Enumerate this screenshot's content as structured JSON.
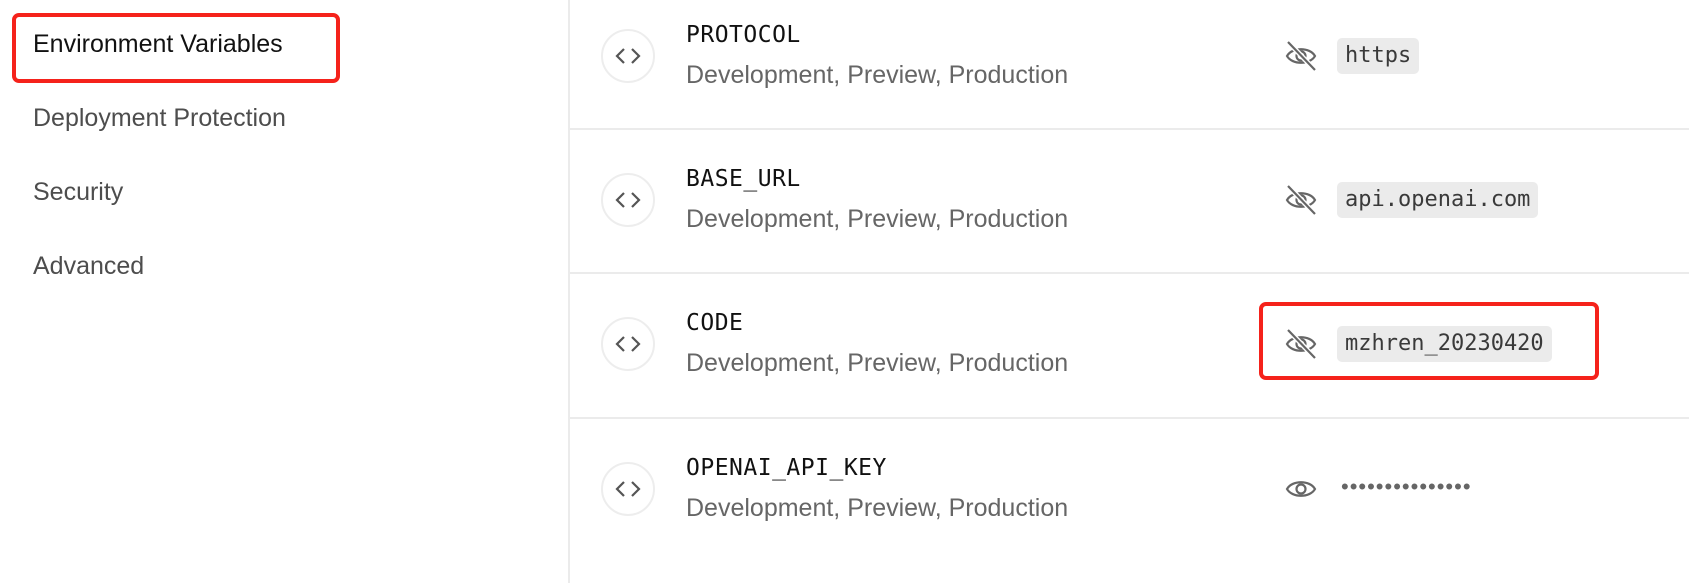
{
  "sidebar": {
    "items": [
      {
        "label": "Environment Variables",
        "active": true
      },
      {
        "label": "Deployment Protection"
      },
      {
        "label": "Security"
      },
      {
        "label": "Advanced"
      }
    ]
  },
  "env_vars": [
    {
      "name": "PROTOCOL",
      "environments": "Development, Preview, Production",
      "value": "https",
      "visible": true
    },
    {
      "name": "BASE_URL",
      "environments": "Development, Preview, Production",
      "value": "api.openai.com",
      "visible": true
    },
    {
      "name": "CODE",
      "environments": "Development, Preview, Production",
      "value": "mzhren_20230420",
      "visible": true
    },
    {
      "name": "OPENAI_API_KEY",
      "environments": "Development, Preview, Production",
      "value": "•••••••••••••••",
      "visible": false
    }
  ],
  "icons": {
    "row_icon": "code-brackets-icon",
    "hide_toggle": "eye-off-icon",
    "show_toggle": "eye-icon"
  },
  "colors": {
    "annotation_highlight": "#f5221b",
    "value_background": "#ebebeb"
  }
}
